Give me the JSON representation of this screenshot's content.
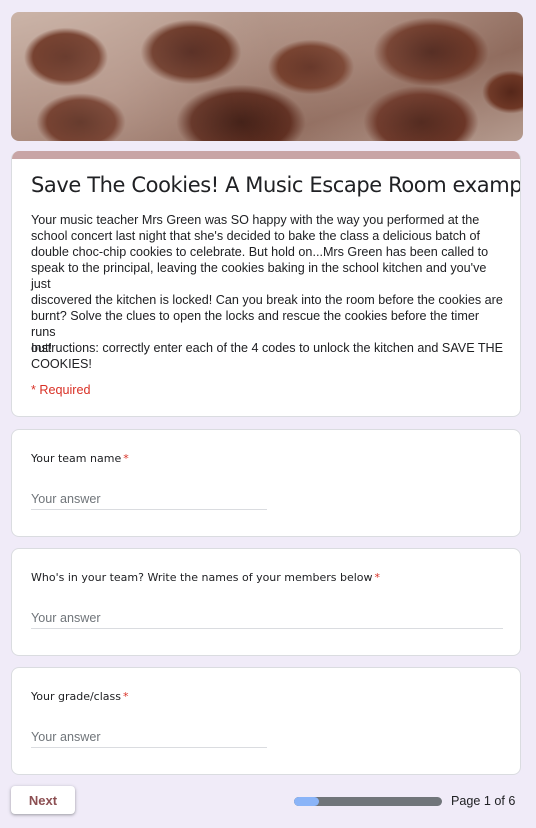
{
  "colors": {
    "accent": "#c8a5a6",
    "accent_dark": "#8c4f52",
    "page_bg": "#f0ebf8",
    "required": "#d93025",
    "progress_fill": "#8ab4f8",
    "progress_track": "#70757a"
  },
  "banner": {
    "alt": "chocolate chip cookies photo"
  },
  "form": {
    "title": "Save The Cookies! A Music Escape Room example",
    "description": "Your music teacher Mrs Green was SO happy with the way you performed at the\nschool concert last night that she's decided to bake the class a delicious batch of\ndouble choc-chip cookies to celebrate.  But hold on...Mrs Green has been called to\nspeak to the principal, leaving the cookies baking in the school kitchen and you've just\ndiscovered the kitchen is locked! Can you break into the room before the cookies are\nburnt? Solve the clues to open the locks and rescue the cookies before the timer runs\nout!",
    "instructions": "Instructions: correctly enter each of the 4 codes to unlock the kitchen and SAVE THE COOKIES!",
    "required_note": "* Required"
  },
  "questions": [
    {
      "label": "Your team name",
      "required_mark": "*",
      "placeholder": "Your answer"
    },
    {
      "label": "Who's in your team? Write the names of your members below",
      "required_mark": "*",
      "placeholder": "Your answer"
    },
    {
      "label": "Your grade/class",
      "required_mark": "*",
      "placeholder": "Your answer"
    }
  ],
  "footer": {
    "next_label": "Next",
    "page_label": "Page 1 of 6",
    "progress_fraction": 0.1667
  }
}
